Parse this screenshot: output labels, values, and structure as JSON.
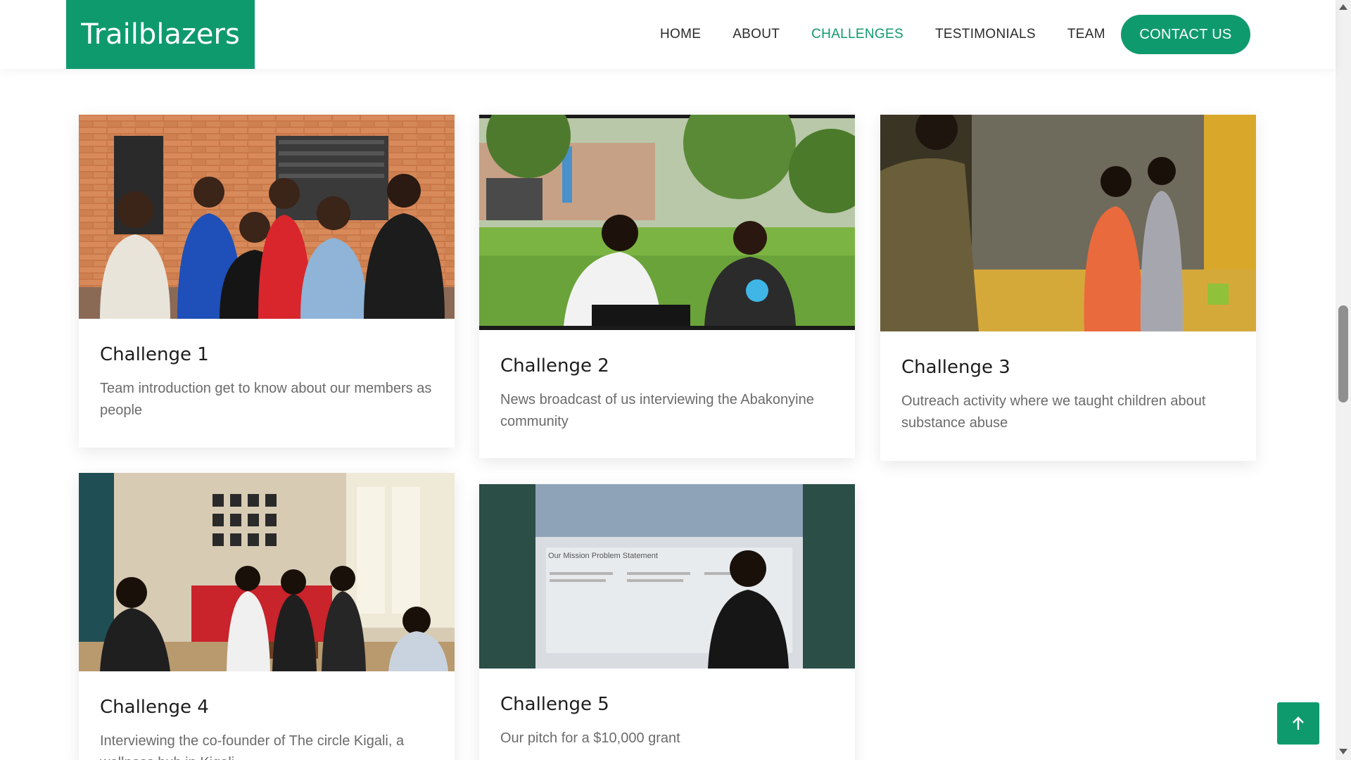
{
  "brand": {
    "name": "Trailblazers",
    "accent": "#0f9a6d"
  },
  "nav": {
    "items": [
      "HOME",
      "ABOUT",
      "CHALLENGES",
      "TESTIMONIALS",
      "TEAM"
    ],
    "active": "CHALLENGES",
    "contact_label": "CONTACT US"
  },
  "challenges": [
    {
      "title": "Challenge 1",
      "description": "Team introduction get to know about our members as people",
      "image": "group-photo-brick-wall"
    },
    {
      "title": "Challenge 2",
      "description": "News broadcast of us interviewing the Abakonyine community",
      "image": "outdoor-interview"
    },
    {
      "title": "Challenge 3",
      "description": "Outreach activity where we taught children about substance abuse",
      "image": "classroom-outreach"
    },
    {
      "title": "Challenge 4",
      "description": "Interviewing the co-founder of The circle Kigali, a wellness hub in Kigali",
      "image": "living-room-interview"
    },
    {
      "title": "Challenge 5",
      "description": "Our pitch for a $10,000 grant",
      "image": "pitch-presentation"
    }
  ],
  "slides": {
    "pitch_heading": "Our Mission  Problem Statement"
  },
  "icons": {
    "back_to_top": "arrow-up-icon"
  }
}
